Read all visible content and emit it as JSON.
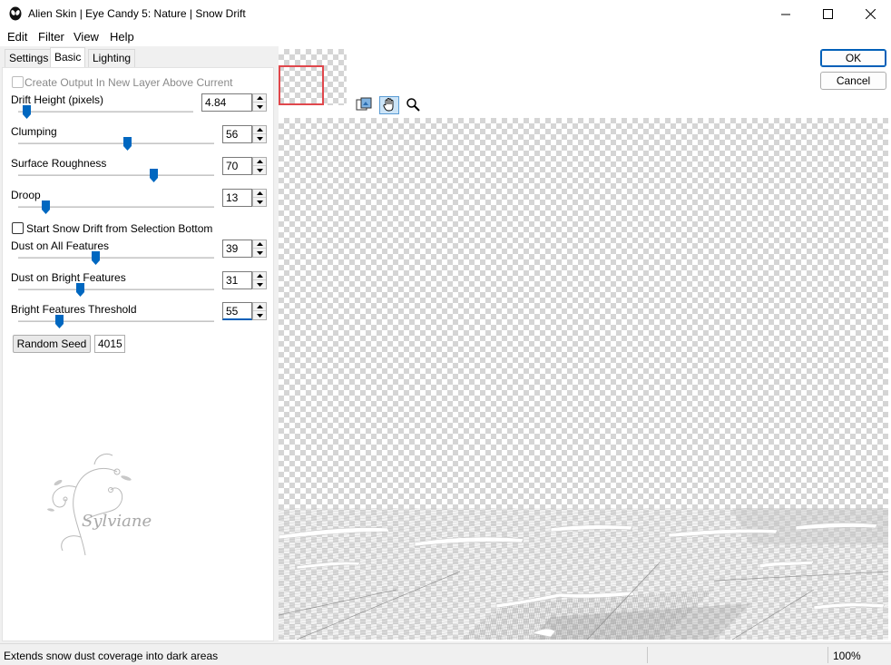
{
  "window": {
    "title": "Alien Skin | Eye Candy 5: Nature | Snow Drift",
    "minimize_glyph": "—",
    "maximize_glyph": "☐",
    "close_glyph": "✕"
  },
  "menu": [
    "Edit",
    "Filter",
    "View",
    "Help"
  ],
  "tabs": [
    "Settings",
    "Basic",
    "Lighting"
  ],
  "active_tab": "Basic",
  "controls": {
    "create_output": {
      "label": "Create Output In New Layer Above Current",
      "checked": false,
      "disabled": true
    },
    "drift_height": {
      "label": "Drift Height (pixels)",
      "value": "4.84",
      "slider_fraction": 0.05
    },
    "clumping": {
      "label": "Clumping",
      "value": "56",
      "slider_fraction": 0.56
    },
    "surface_roughness": {
      "label": "Surface Roughness",
      "value": "70",
      "slider_fraction": 0.7
    },
    "droop": {
      "label": "Droop",
      "value": "13",
      "slider_fraction": 0.13
    },
    "start_snow_drift": {
      "label": "Start Snow Drift from Selection Bottom",
      "checked": false
    },
    "dust_all": {
      "label": "Dust on All Features",
      "value": "39",
      "slider_fraction": 0.39
    },
    "dust_bright": {
      "label": "Dust on Bright Features",
      "value": "31",
      "slider_fraction": 0.31
    },
    "bright_threshold": {
      "label": "Bright Features Threshold",
      "value": "55",
      "slider_fraction": 0.21
    },
    "random_seed": {
      "label": "Random Seed",
      "value": "4015"
    }
  },
  "watermark": {
    "signature": "Sylviane"
  },
  "buttons": {
    "ok": "OK",
    "cancel": "Cancel"
  },
  "status": {
    "message": "Extends snow dust coverage into dark areas",
    "zoom": "100%"
  },
  "colors": {
    "accent": "#0067c0",
    "nav_rect": "#e0474c",
    "focus_underline": "#005fb8"
  },
  "icons": [
    "alien-skin-icon",
    "preview-compare-icon",
    "hand-pan-icon",
    "zoom-icon",
    "spin-up-icon",
    "spin-down-icon"
  ]
}
